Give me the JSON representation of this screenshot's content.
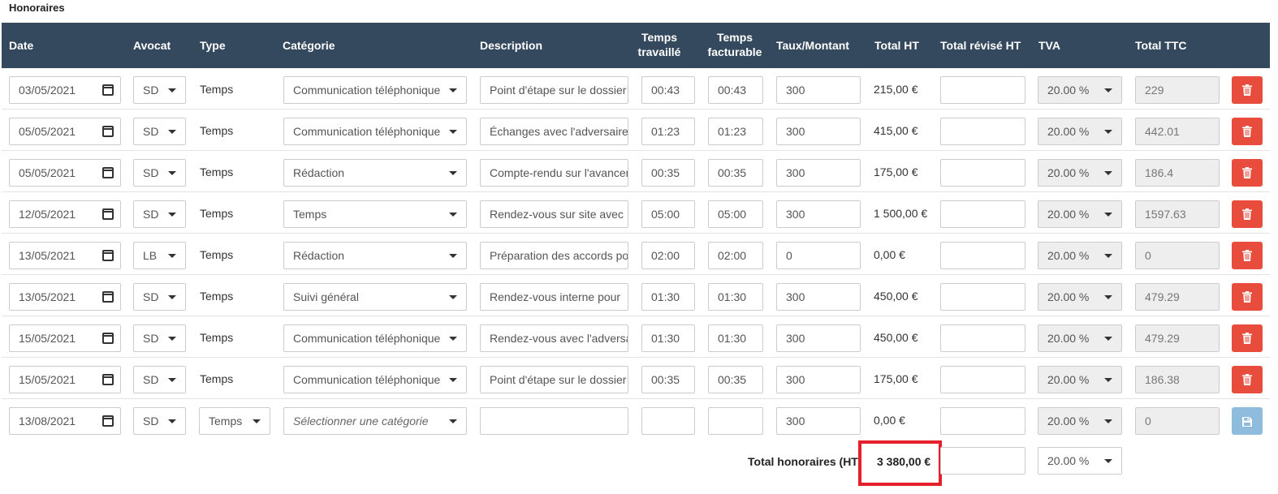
{
  "section_title": "Honoraires",
  "headers": {
    "date": "Date",
    "avocat": "Avocat",
    "type": "Type",
    "categorie": "Catégorie",
    "description": "Description",
    "temps_travaille_1": "Temps",
    "temps_travaille_2": "travaillé",
    "temps_facturable_1": "Temps",
    "temps_facturable_2": "facturable",
    "taux": "Taux/Montant",
    "total_ht": "Total HT",
    "total_revise": "Total révisé HT",
    "tva": "TVA",
    "total_ttc": "Total TTC"
  },
  "rows": [
    {
      "date": "03/05/2021",
      "avocat": "SD",
      "type": "Temps",
      "categorie": "Communication téléphonique",
      "description": "Point d'étape sur le dossier",
      "travaille": "00:43",
      "facturable": "00:43",
      "taux": "300",
      "total_ht": "215,00 €",
      "revise": "",
      "tva": "20.00 %",
      "ttc": "229"
    },
    {
      "date": "05/05/2021",
      "avocat": "SD",
      "type": "Temps",
      "categorie": "Communication téléphonique",
      "description": "Échanges avec l'adversaire",
      "travaille": "01:23",
      "facturable": "01:23",
      "taux": "300",
      "total_ht": "415,00 €",
      "revise": "",
      "tva": "20.00 %",
      "ttc": "442.01"
    },
    {
      "date": "05/05/2021",
      "avocat": "SD",
      "type": "Temps",
      "categorie": "Rédaction",
      "description": "Compte-rendu sur l'avancement",
      "travaille": "00:35",
      "facturable": "00:35",
      "taux": "300",
      "total_ht": "175,00 €",
      "revise": "",
      "tva": "20.00 %",
      "ttc": "186.4"
    },
    {
      "date": "12/05/2021",
      "avocat": "SD",
      "type": "Temps",
      "categorie": "Temps",
      "description": "Rendez-vous sur site avec",
      "travaille": "05:00",
      "facturable": "05:00",
      "taux": "300",
      "total_ht": "1 500,00 €",
      "revise": "",
      "tva": "20.00 %",
      "ttc": "1597.63"
    },
    {
      "date": "13/05/2021",
      "avocat": "LB",
      "type": "Temps",
      "categorie": "Rédaction",
      "description": "Préparation des accords pour",
      "travaille": "02:00",
      "facturable": "02:00",
      "taux": "0",
      "total_ht": "0,00 €",
      "revise": "",
      "tva": "20.00 %",
      "ttc": "0"
    },
    {
      "date": "13/05/2021",
      "avocat": "SD",
      "type": "Temps",
      "categorie": "Suivi général",
      "description": "Rendez-vous interne pour",
      "travaille": "01:30",
      "facturable": "01:30",
      "taux": "300",
      "total_ht": "450,00 €",
      "revise": "",
      "tva": "20.00 %",
      "ttc": "479.29"
    },
    {
      "date": "15/05/2021",
      "avocat": "SD",
      "type": "Temps",
      "categorie": "Communication téléphonique",
      "description": "Rendez-vous avec l'adversaire",
      "travaille": "01:30",
      "facturable": "01:30",
      "taux": "300",
      "total_ht": "450,00 €",
      "revise": "",
      "tva": "20.00 %",
      "ttc": "479.29"
    },
    {
      "date": "15/05/2021",
      "avocat": "SD",
      "type": "Temps",
      "categorie": "Communication téléphonique",
      "description": "Point d'étape sur le dossier",
      "travaille": "00:35",
      "facturable": "00:35",
      "taux": "300",
      "total_ht": "175,00 €",
      "revise": "",
      "tva": "20.00 %",
      "ttc": "186.38"
    }
  ],
  "new_row": {
    "date": "13/08/2021",
    "avocat": "SD",
    "type": "Temps",
    "categorie_placeholder": "Sélectionner une catégorie",
    "description": "",
    "travaille": "",
    "facturable": "",
    "taux": "300",
    "total_ht": "0,00 €",
    "revise": "",
    "tva": "20.00 %",
    "ttc": "0"
  },
  "footer": {
    "label": "Total honoraires (HT)",
    "total": "3 380,00 €",
    "tva": "20.00 %"
  },
  "colors": {
    "header": "#34495e",
    "delete": "#e74c3c",
    "save": "#8fbcdc",
    "highlight": "#e5202c"
  },
  "icons": {
    "date": "calendar-icon",
    "delete": "trash-icon",
    "save": "floppy-disk-icon",
    "dropdown": "caret-down-icon"
  }
}
